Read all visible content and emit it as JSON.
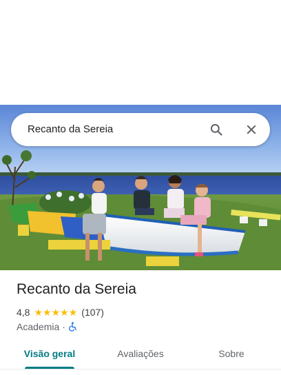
{
  "search": {
    "query": "Recanto da Sereia",
    "search_icon": "search-icon",
    "close_icon": "close-icon"
  },
  "photo": {
    "description_icon": "place-photo"
  },
  "place": {
    "name": "Recanto da Sereia",
    "rating": "4,8",
    "stars": 5,
    "reviews": "(107)",
    "category": "Academia",
    "separator": "·",
    "accessibility_icon": "wheelchair-icon"
  },
  "tabs": [
    {
      "label": "Visão geral",
      "active": true
    },
    {
      "label": "Avaliações",
      "active": false
    },
    {
      "label": "Sobre",
      "active": false
    }
  ],
  "colors": {
    "accent": "#007b83",
    "star": "#fbbc04",
    "wheelchair": "#1a73e8"
  }
}
